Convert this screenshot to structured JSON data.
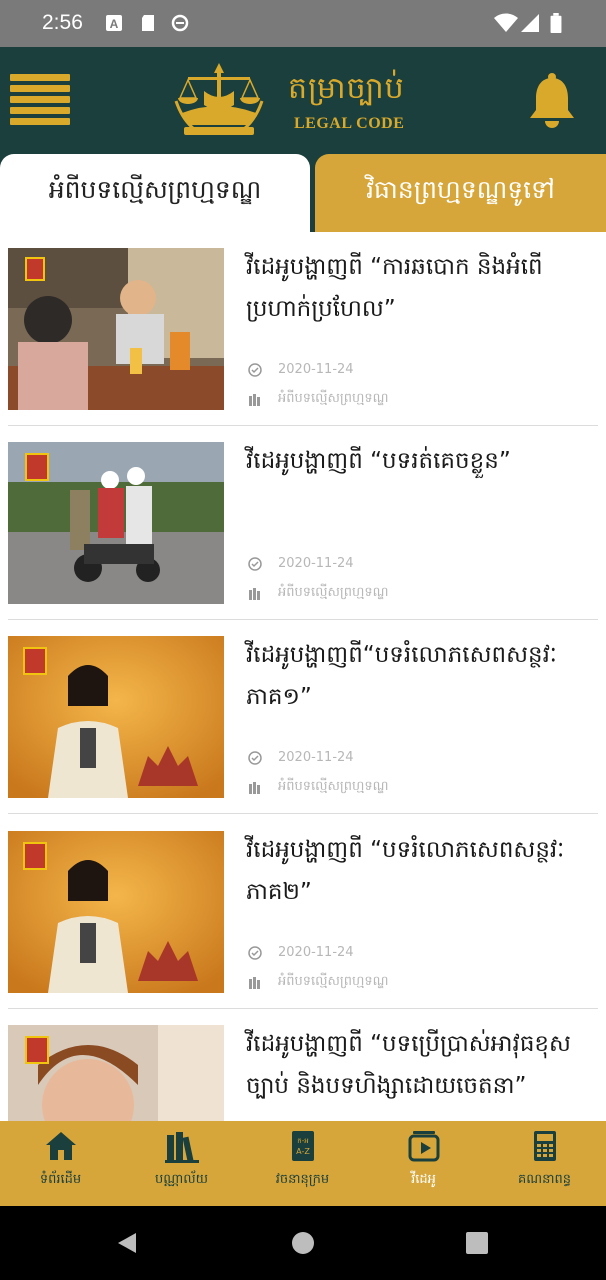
{
  "status_bar": {
    "time": "2:56"
  },
  "app_bar": {
    "logo_khmer": "តម្រាច្បាប់",
    "logo_english": "LEGAL CODE"
  },
  "tabs": [
    {
      "label": "អំពីបទល្មើសព្រហ្មទណ្ឌ",
      "selected": true
    },
    {
      "label": "វិធានព្រហ្មទណ្ឌទូទៅ",
      "selected": false
    }
  ],
  "videos": [
    {
      "title": "វីដេអូបង្ហាញពី “ការឆបោក និងអំពើប្រហាក់ប្រហែល”",
      "date": "2020-11-24",
      "category": "អំពីបទល្មើសព្រហ្មទណ្ឌ"
    },
    {
      "title": "វីដេអូបង្ហាញពី “បទរត់គេចខ្លួន”",
      "date": "2020-11-24",
      "category": "អំពីបទល្មើសព្រហ្មទណ្ឌ"
    },
    {
      "title": "វីដេអូបង្ហាញពី“បទរំលោភសេពសន្ថវៈ ភាគ១”",
      "date": "2020-11-24",
      "category": "អំពីបទល្មើសព្រហ្មទណ្ឌ"
    },
    {
      "title": "វីដេអូបង្ហាញពី “បទរំលោភសេពសន្ថវៈ ភាគ២”",
      "date": "2020-11-24",
      "category": "អំពីបទល្មើសព្រហ្មទណ្ឌ"
    },
    {
      "title": "វីដេអូបង្ហាញពី “បទប្រើប្រាស់អាវុធខុសច្បាប់ និងបទហិង្សាដោយចេតនា”",
      "date": "",
      "category": ""
    }
  ],
  "bottom_nav": [
    {
      "label": "ទំព័រដើម",
      "icon": "home-icon",
      "active": false
    },
    {
      "label": "បណ្ណាល័យ",
      "icon": "books-icon",
      "active": false
    },
    {
      "label": "វចនានុក្រម",
      "icon": "dictionary-icon",
      "active": false
    },
    {
      "label": "វីដេអូ",
      "icon": "video-icon",
      "active": true
    },
    {
      "label": "គណនាពន្ធ",
      "icon": "calculator-icon",
      "active": false
    }
  ],
  "colors": {
    "app_bar": "#1a3f3c",
    "accent_gold": "#d6a63a",
    "logo_gold": "#d9a92c",
    "meta_gray": "#b7b7b7"
  }
}
